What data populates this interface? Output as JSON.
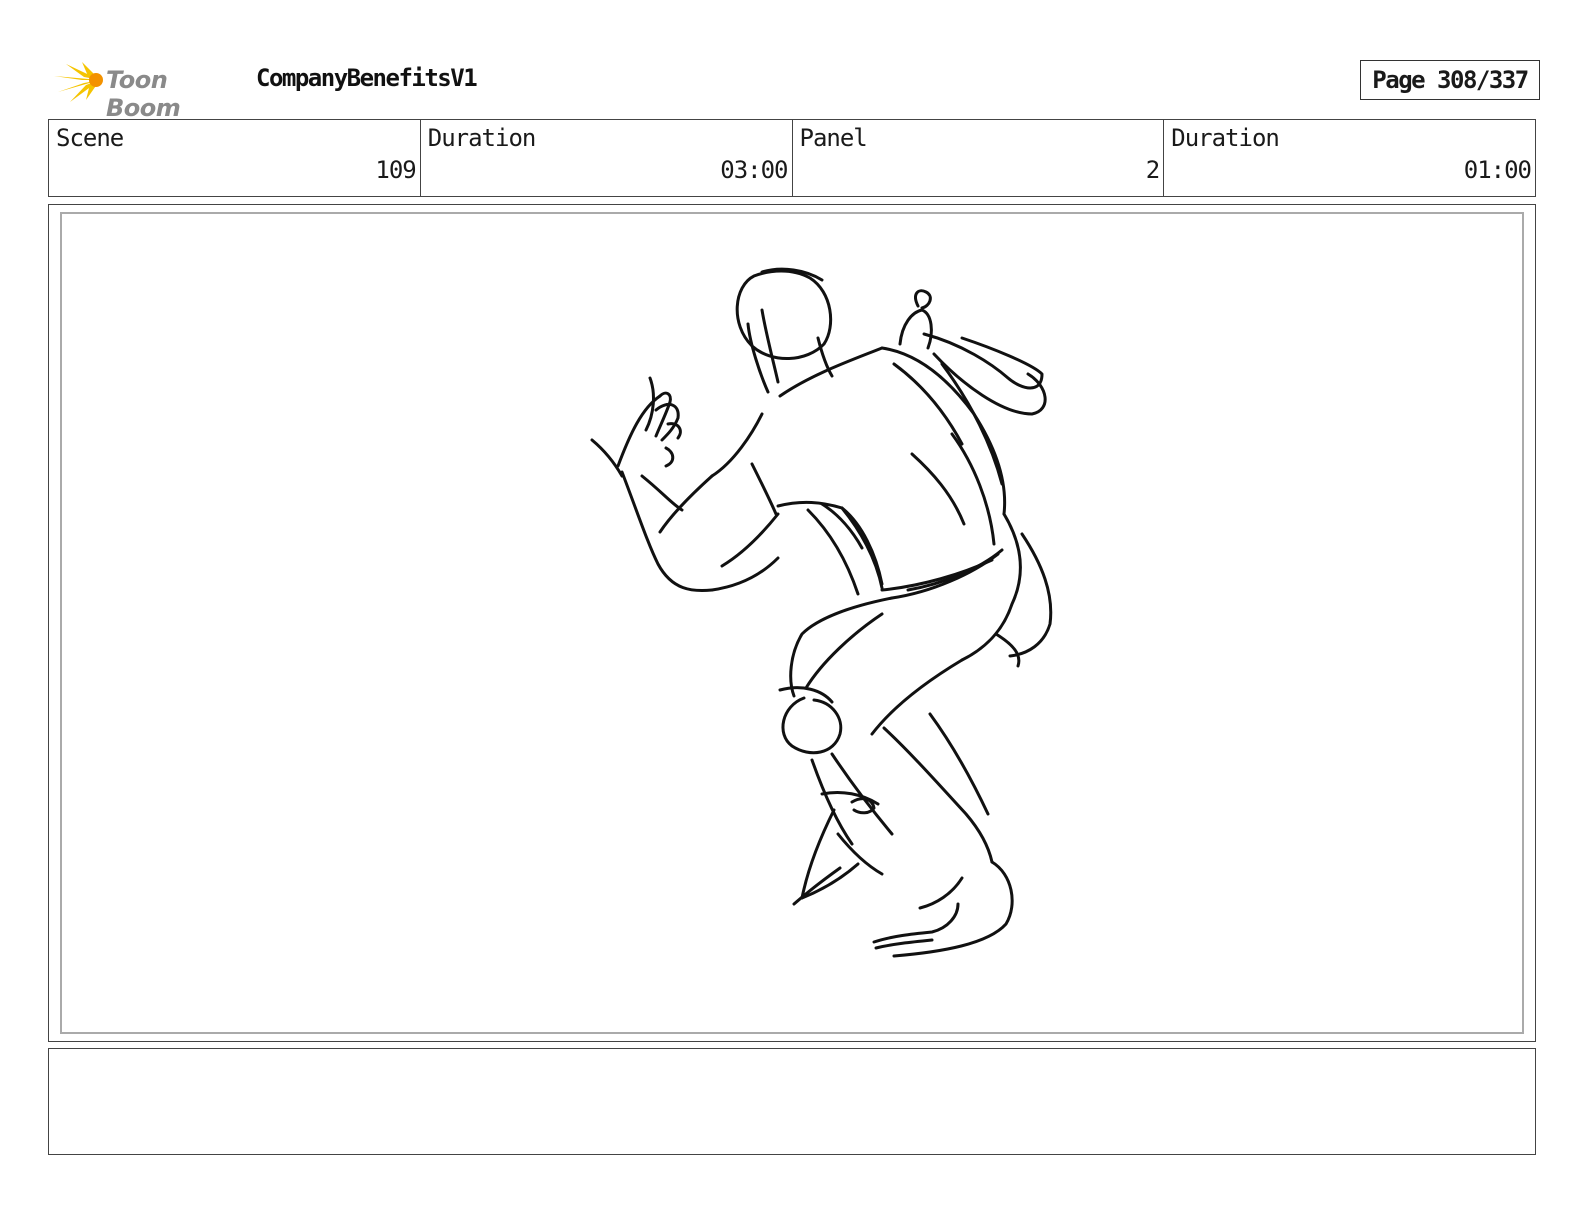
{
  "header": {
    "logo_text": "Toon Boom",
    "project_title": "CompanyBenefitsV1",
    "page_label": "Page 308/337"
  },
  "info": {
    "scene_label": "Scene",
    "scene_value": "109",
    "scene_duration_label": "Duration",
    "scene_duration_value": "03:00",
    "panel_label": "Panel",
    "panel_value": "2",
    "panel_duration_label": "Duration",
    "panel_duration_value": "01:00"
  },
  "panel": {
    "sketch_icon": "crouching-figure-sketch"
  },
  "notes": {
    "text": ""
  },
  "colors": {
    "logo_yellow": "#f5c400",
    "logo_orange": "#f39200",
    "border": "#444444",
    "ink": "#111111"
  }
}
